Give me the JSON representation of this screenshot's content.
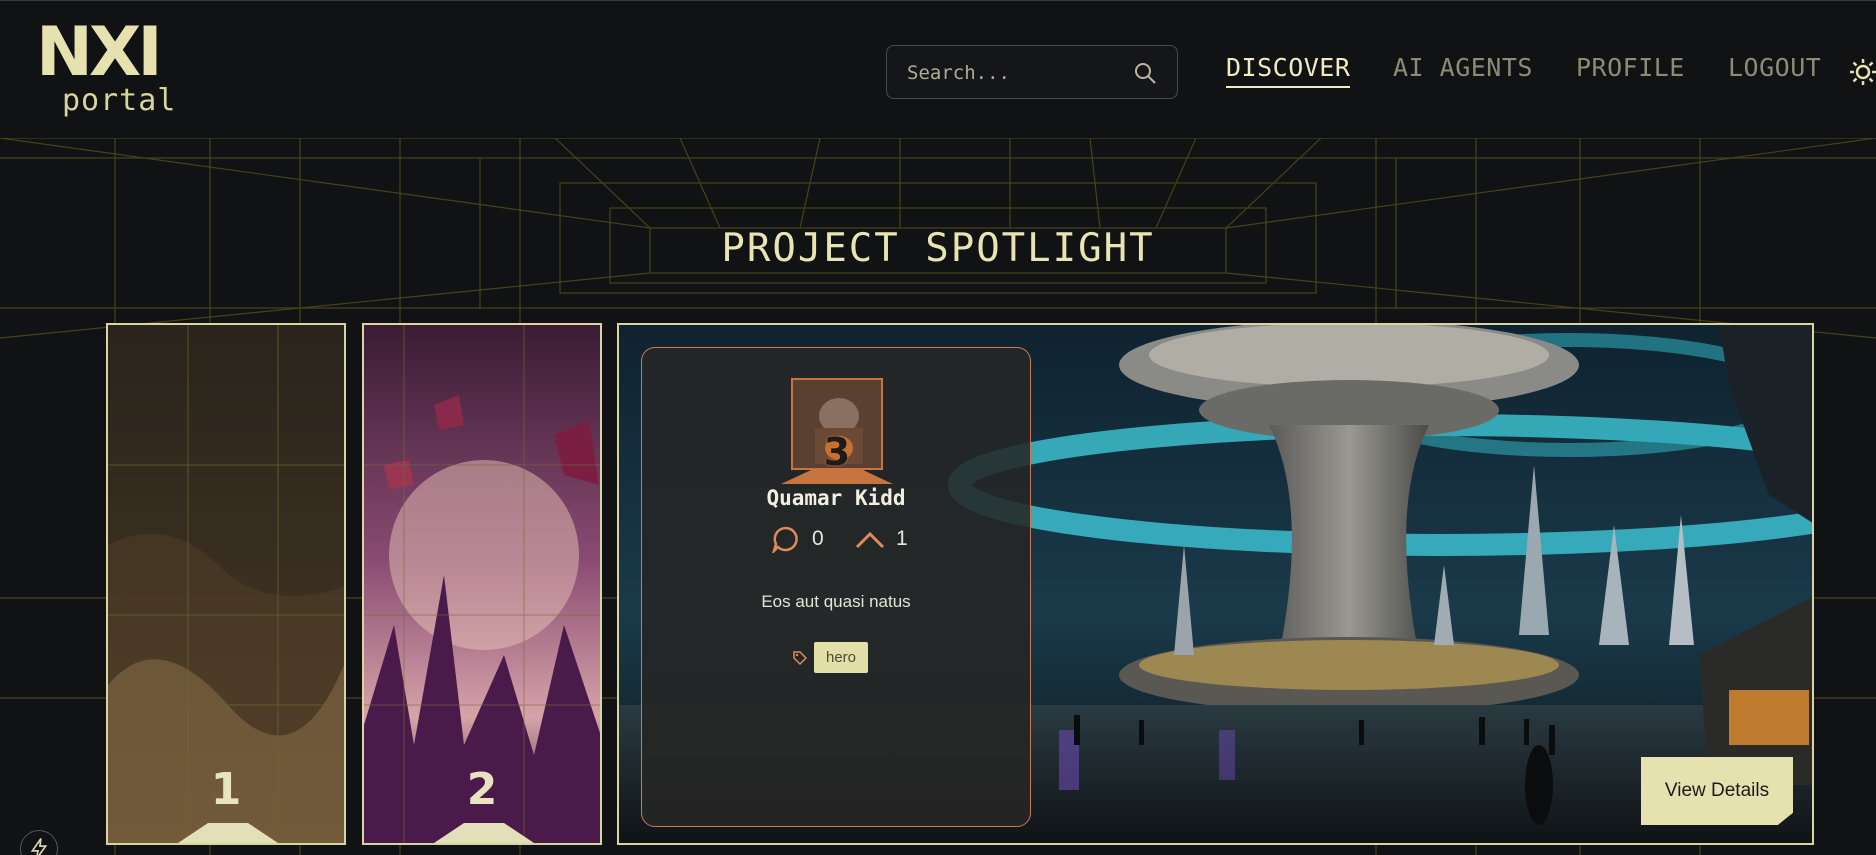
{
  "header": {
    "logo_mark": "NXI",
    "logo_sub": "portal",
    "search": {
      "placeholder": "Search..."
    },
    "nav": [
      {
        "label": "DISCOVER",
        "active": true
      },
      {
        "label": "AI AGENTS",
        "active": false
      },
      {
        "label": "PROFILE",
        "active": false
      },
      {
        "label": "LOGOUT",
        "active": false
      }
    ],
    "theme_icon": "sun-icon"
  },
  "spotlight": {
    "title": "PROJECT SPOTLIGHT",
    "cards": [
      {
        "rank": "1"
      },
      {
        "rank": "2"
      }
    ],
    "featured": {
      "rank": "3",
      "name": "Quamar Kidd",
      "comments": "0",
      "upvotes": "1",
      "description": "Eos aut quasi natus",
      "tags": [
        "hero"
      ],
      "button": "View Details"
    }
  },
  "colors": {
    "accent": "#e6e2b0",
    "background": "#111214",
    "panel_border": "#c77a55",
    "avatar_border": "#c7743f"
  }
}
